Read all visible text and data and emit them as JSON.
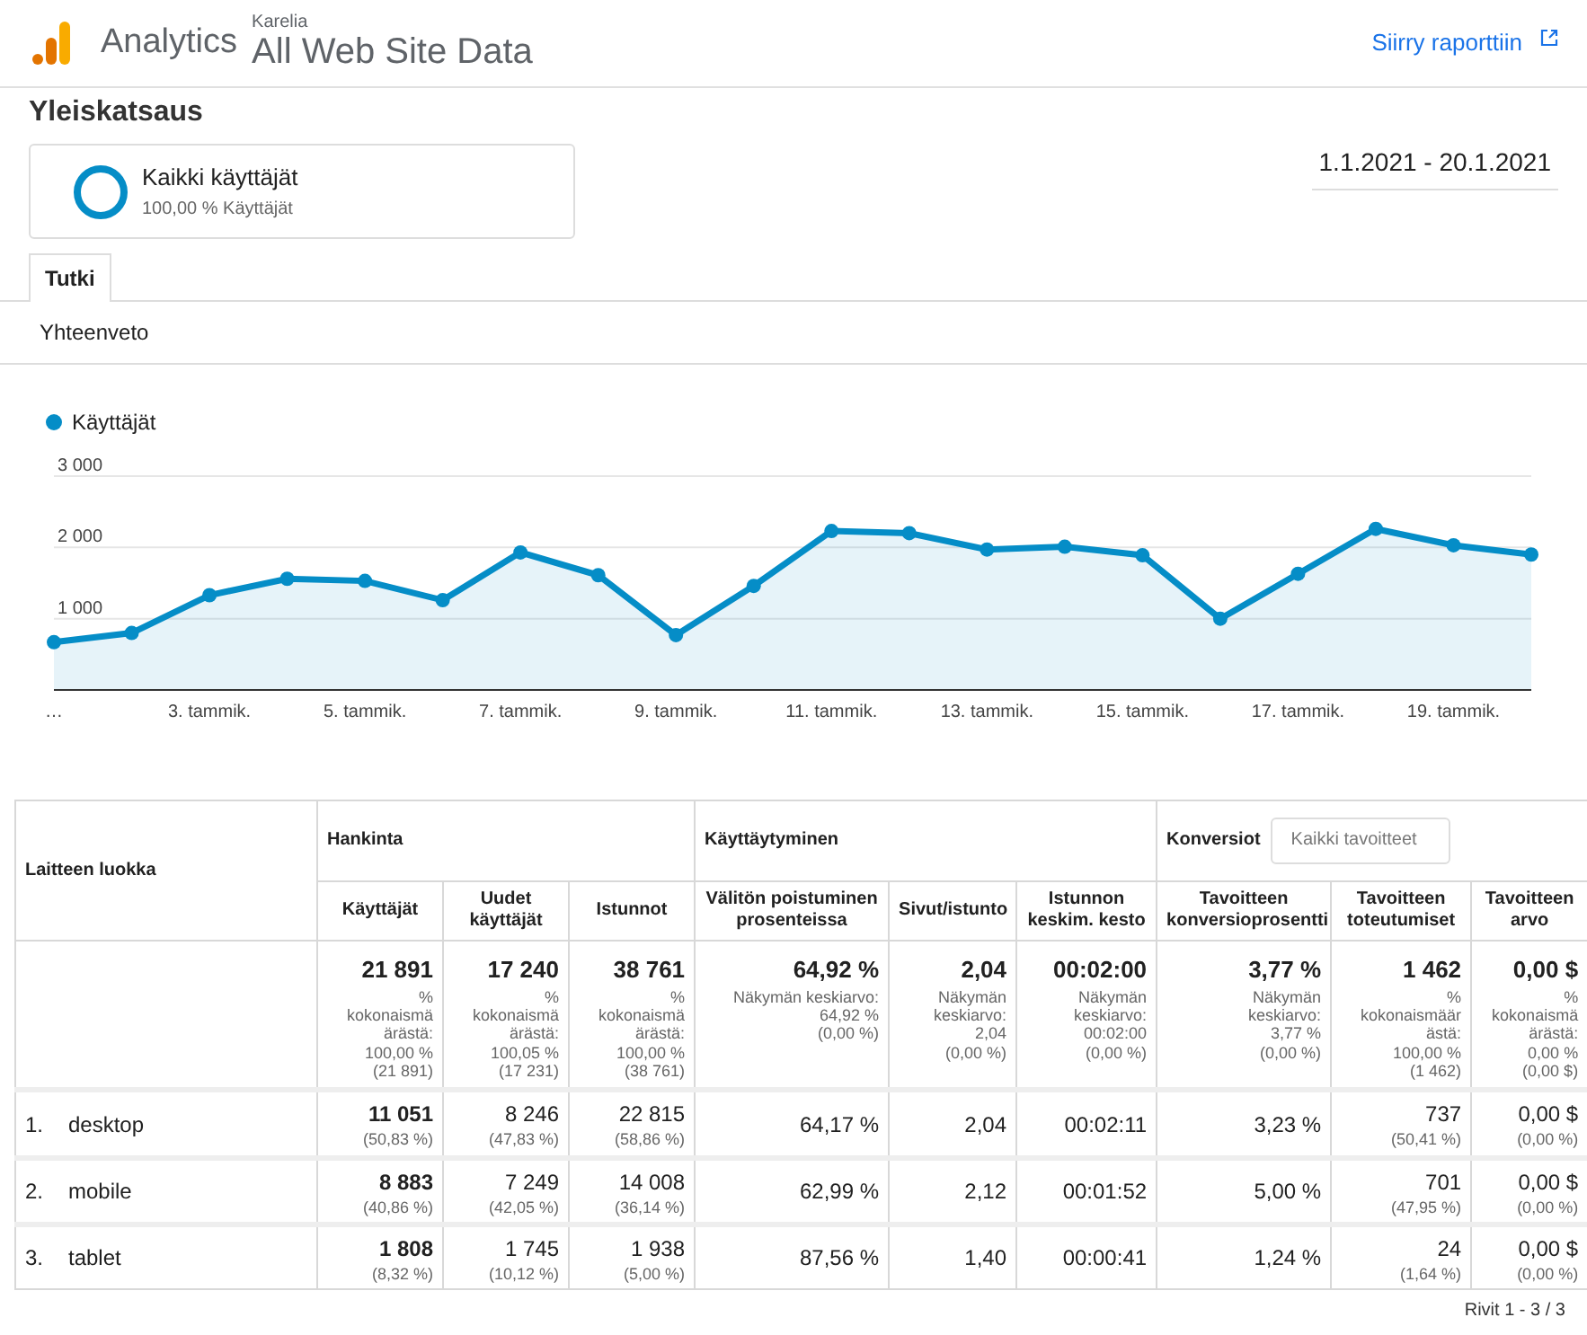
{
  "app": {
    "product": "Analytics",
    "account": "Karelia",
    "property": "All Web Site Data",
    "report_link": "Siirry raporttiin"
  },
  "page_title": "Yleiskatsaus",
  "segment": {
    "name": "Kaikki käyttäjät",
    "detail": "100,00 % Käyttäjät"
  },
  "date_range": "1.1.2021 - 20.1.2021",
  "tabs": [
    {
      "label": "Tutki",
      "selected": true
    }
  ],
  "subtab": "Yhteenveto",
  "chart": {
    "chart_data": {
      "type": "area",
      "xlim": [
        1,
        20
      ],
      "x": [
        1,
        2,
        3,
        4,
        5,
        6,
        7,
        8,
        9,
        10,
        11,
        12,
        13,
        14,
        15,
        16,
        17,
        18,
        19,
        20
      ],
      "series": [
        {
          "name": "Käyttäjät",
          "color": "#058dc7",
          "marker": "circle",
          "values": [
            670,
            800,
            1330,
            1560,
            1530,
            1260,
            1930,
            1610,
            770,
            1460,
            2230,
            2200,
            1970,
            2010,
            1890,
            1000,
            1630,
            2260,
            2030,
            1900
          ]
        }
      ],
      "ylim": [
        0,
        3000
      ],
      "yticks": [
        {
          "value": 1000,
          "label": "1 000"
        },
        {
          "value": 2000,
          "label": "2 000"
        },
        {
          "value": 3000,
          "label": "3 000"
        }
      ],
      "xticks": [
        {
          "value": 1,
          "label": "…"
        },
        {
          "value": 3,
          "label": "3. tammik."
        },
        {
          "value": 5,
          "label": "5. tammik."
        },
        {
          "value": 7,
          "label": "7. tammik."
        },
        {
          "value": 9,
          "label": "9. tammik."
        },
        {
          "value": 11,
          "label": "11. tammik."
        },
        {
          "value": 13,
          "label": "13. tammik."
        },
        {
          "value": 15,
          "label": "15. tammik."
        },
        {
          "value": 17,
          "label": "17. tammik."
        },
        {
          "value": 19,
          "label": "19. tammik."
        }
      ]
    }
  },
  "table": {
    "dimension_header": "Laitteen luokka",
    "groups": [
      {
        "label": "Hankinta",
        "columns": [
          {
            "label": "Käyttäjät",
            "emphasized": true
          },
          {
            "label": "Uudet käyttäjät",
            "emphasized": false
          },
          {
            "label": "Istunnot",
            "emphasized": false
          }
        ]
      },
      {
        "label": "Käyttäytyminen",
        "columns": [
          {
            "label": "Välitön poistuminen prosenteissa",
            "emphasized": false
          },
          {
            "label": "Sivut/istunto",
            "emphasized": false
          },
          {
            "label": "Istunnon keskim. kesto",
            "emphasized": false
          }
        ]
      },
      {
        "label": "Konversiot",
        "selector": "Kaikki tavoitteet",
        "columns": [
          {
            "label": "Tavoitteen konversioprosentti",
            "emphasized": false
          },
          {
            "label": "Tavoitteen toteutumiset",
            "emphasized": false
          },
          {
            "label": "Tavoitteen arvo",
            "emphasized": false
          }
        ]
      }
    ],
    "totals": [
      {
        "value": "21 891",
        "note": [
          "%",
          "kokonaismä",
          "ärästä:",
          "100,00 %",
          "(21 891)"
        ]
      },
      {
        "value": "17 240",
        "note": [
          "%",
          "kokonaismä",
          "ärästä:",
          "100,05 %",
          "(17 231)"
        ]
      },
      {
        "value": "38 761",
        "note": [
          "%",
          "kokonaismä",
          "ärästä:",
          "100,00 %",
          "(38 761)"
        ]
      },
      {
        "value": "64,92 %",
        "note": [
          "Näkymän keskiarvo:",
          "64,92 %",
          "(0,00 %)"
        ]
      },
      {
        "value": "2,04",
        "note": [
          "Näkymän",
          "keskiarvo:",
          "2,04",
          "(0,00 %)"
        ]
      },
      {
        "value": "00:02:00",
        "note": [
          "Näkymän",
          "keskiarvo:",
          "00:02:00",
          "(0,00 %)"
        ]
      },
      {
        "value": "3,77 %",
        "note": [
          "Näkymän",
          "keskiarvo:",
          "3,77 %",
          "(0,00 %)"
        ]
      },
      {
        "value": "1 462",
        "note": [
          "%",
          "kokonaismäär",
          "ästä:",
          "100,00 %",
          "(1 462)"
        ]
      },
      {
        "value": "0,00 $",
        "note": [
          "%",
          "kokonaismä",
          "ärästä:",
          "0,00 %",
          "(0,00 $)"
        ]
      }
    ],
    "rows": [
      {
        "index": "1.",
        "name": "desktop",
        "cells": [
          {
            "value": "11 051",
            "note": "(50,83 %)"
          },
          {
            "value": "8 246",
            "note": "(47,83 %)"
          },
          {
            "value": "22 815",
            "note": "(58,86 %)"
          },
          {
            "value": "64,17 %"
          },
          {
            "value": "2,04"
          },
          {
            "value": "00:02:11"
          },
          {
            "value": "3,23 %"
          },
          {
            "value": "737",
            "note": "(50,41 %)"
          },
          {
            "value": "0,00 $",
            "note": "(0,00 %)"
          }
        ]
      },
      {
        "index": "2.",
        "name": "mobile",
        "cells": [
          {
            "value": "8 883",
            "note": "(40,86 %)"
          },
          {
            "value": "7 249",
            "note": "(42,05 %)"
          },
          {
            "value": "14 008",
            "note": "(36,14 %)"
          },
          {
            "value": "62,99 %"
          },
          {
            "value": "2,12"
          },
          {
            "value": "00:01:52"
          },
          {
            "value": "5,00 %"
          },
          {
            "value": "701",
            "note": "(47,95 %)"
          },
          {
            "value": "0,00 $",
            "note": "(0,00 %)"
          }
        ]
      },
      {
        "index": "3.",
        "name": "tablet",
        "cells": [
          {
            "value": "1 808",
            "note": "(8,32 %)"
          },
          {
            "value": "1 745",
            "note": "(10,12 %)"
          },
          {
            "value": "1 938",
            "note": "(5,00 %)"
          },
          {
            "value": "87,56 %"
          },
          {
            "value": "1,40"
          },
          {
            "value": "00:00:41"
          },
          {
            "value": "1,24 %"
          },
          {
            "value": "24",
            "note": "(1,64 %)"
          },
          {
            "value": "0,00 $",
            "note": "(0,00 %)"
          }
        ]
      }
    ]
  },
  "footer": "Rivit 1 - 3 / 3"
}
